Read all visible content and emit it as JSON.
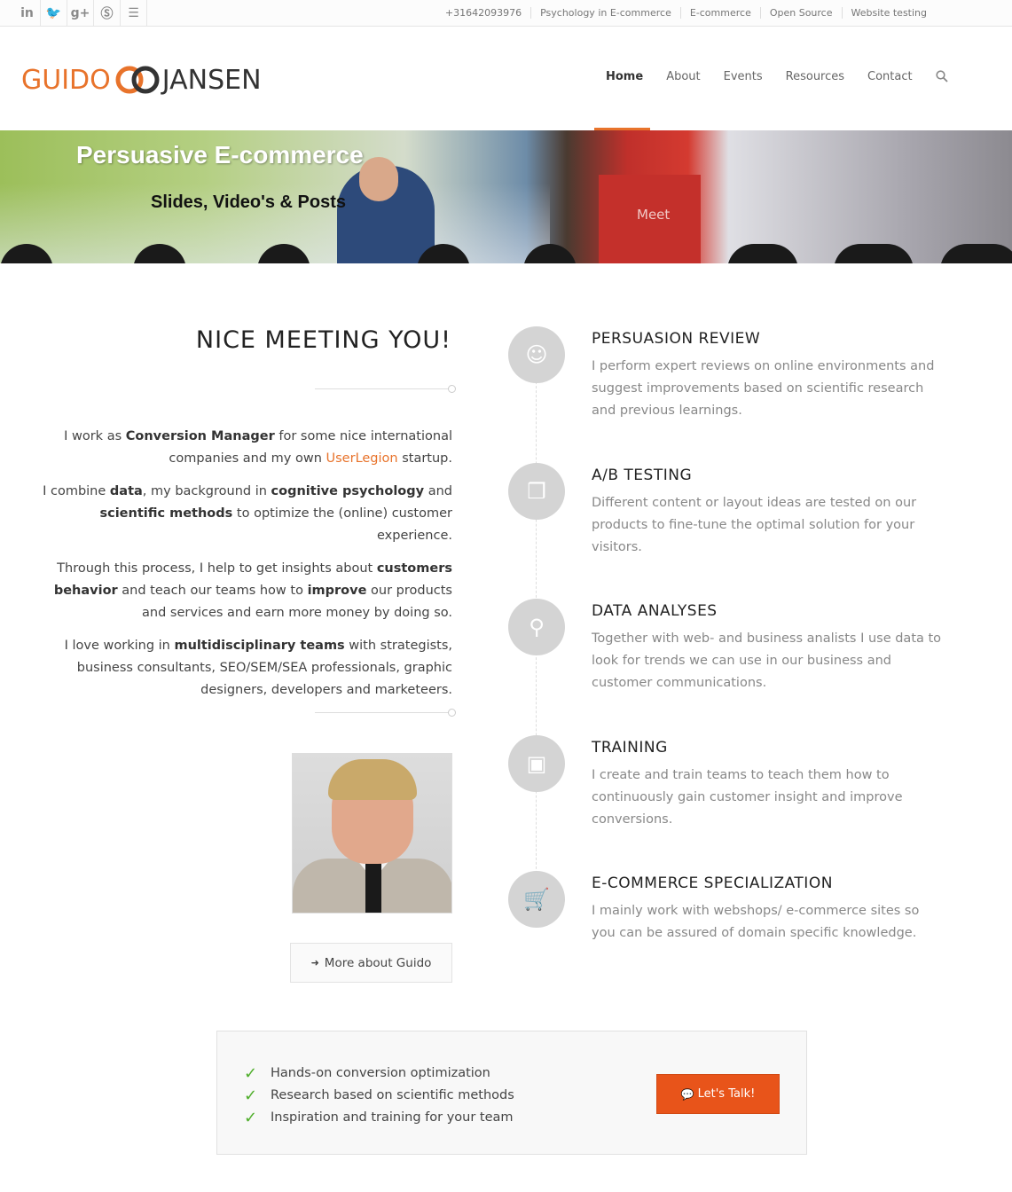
{
  "topbar": {
    "social": [
      {
        "icon": "linkedin-icon",
        "glyph": "in"
      },
      {
        "icon": "twitter-icon",
        "glyph": "🐦"
      },
      {
        "icon": "google-plus-icon",
        "glyph": "g+"
      },
      {
        "icon": "skype-icon",
        "glyph": "Ⓢ"
      },
      {
        "icon": "rss-icon",
        "glyph": "☰"
      }
    ],
    "phone": "+31642093976",
    "links": [
      "Psychology in E-commerce",
      "E-commerce",
      "Open Source",
      "Website testing"
    ]
  },
  "header": {
    "logo_left": "GUIDO",
    "logo_right": "JANSEN",
    "nav": [
      "Home",
      "About",
      "Events",
      "Resources",
      "Contact"
    ],
    "active": "Home",
    "search_icon": "search-icon",
    "accent": "#e8732b"
  },
  "banner": {
    "title": "Persuasive E-commerce",
    "subtitle": "Slides, Video's & Posts",
    "sign": "Meet"
  },
  "intro": {
    "title": "NICE MEETING YOU!",
    "p1": {
      "a": "I work as ",
      "b": "Conversion Manager",
      "c": " for some nice international companies and my own ",
      "link": "UserLegion",
      "d": " startup."
    },
    "p2": {
      "a": "I combine ",
      "b": "data",
      "c": ", my background in ",
      "d": "cognitive psychology",
      "e": " and ",
      "f": "scientific methods",
      "g": " to optimize the (online) customer experience."
    },
    "p3": {
      "a": "Through this process, I help to get insights about  ",
      "b": "customers behavior",
      "c": " and teach our teams how to ",
      "d": "improve",
      "e": " our products and services and earn more money by doing so."
    },
    "p4": {
      "a": "I love working in ",
      "b": "multidisciplinary teams",
      "c": " with strategists, business consultants, SEO/SEM/SEA professionals, graphic designers, developers and marketeers."
    },
    "more_button": "More about Guido"
  },
  "features": [
    {
      "icon": "brain-head-icon",
      "glyph": "☺",
      "title": "PERSUASION REVIEW",
      "text": "I perform expert reviews on online environments and suggest improvements based on scientific research and previous learnings."
    },
    {
      "icon": "layers-icon",
      "glyph": "❒",
      "title": "A/B TESTING",
      "text": "Different content or layout ideas are tested on our products to fine-tune the optimal solution for your visitors."
    },
    {
      "icon": "analytics-icon",
      "glyph": "⚲",
      "title": "DATA ANALYSES",
      "text": "Together with web- and business analists I use data to look for trends we can use in our business and customer communications."
    },
    {
      "icon": "presentation-icon",
      "glyph": "▣",
      "title": "TRAINING",
      "text": "I create and train teams to teach them how to continuously gain customer insight and improve conversions."
    },
    {
      "icon": "cart-icon",
      "glyph": "🛒",
      "title": "E-COMMERCE SPECIALIZATION",
      "text": "I mainly work with webshops/ e-commerce sites so you can be assured of domain specific knowledge."
    }
  ],
  "cta": {
    "items": [
      "Hands-on conversion optimization",
      "Research based on scientific methods",
      "Inspiration and training for your team"
    ],
    "button": "Let's Talk!",
    "button_color": "#e8541a"
  }
}
